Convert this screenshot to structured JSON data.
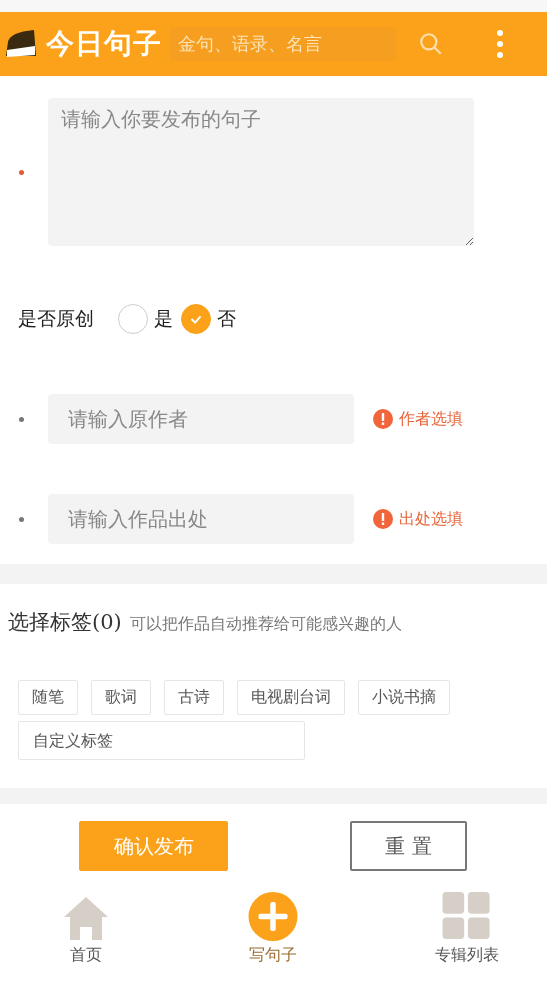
{
  "header": {
    "logo_text": "今日句子",
    "search": {
      "placeholder": "金句、语录、名言"
    }
  },
  "sentence": {
    "placeholder": "请输入你要发布的句子",
    "required": true
  },
  "original": {
    "label": "是否原创",
    "options": [
      {
        "label": "是",
        "selected": false
      },
      {
        "label": "否",
        "selected": true
      }
    ]
  },
  "fields": [
    {
      "placeholder": "请输入原作者",
      "required": false,
      "hint": "作者选填"
    },
    {
      "placeholder": "请输入作品出处",
      "required": false,
      "hint": "出处选填"
    }
  ],
  "tags": {
    "title": "选择标签(0)",
    "subtitle": "可以把作品自动推荐给可能感兴趣的人",
    "items": [
      "随笔",
      "歌词",
      "古诗",
      "电视剧台词",
      "小说书摘"
    ],
    "custom": {
      "placeholder": "自定义标签"
    }
  },
  "buttons": {
    "submit": "确认发布",
    "reset": "重 置"
  },
  "nav": [
    {
      "kind": "home",
      "label": "首页",
      "selected": false
    },
    {
      "kind": "write",
      "label": "写句子",
      "selected": true
    },
    {
      "kind": "albums",
      "label": "专辑列表",
      "selected": false
    }
  ]
}
